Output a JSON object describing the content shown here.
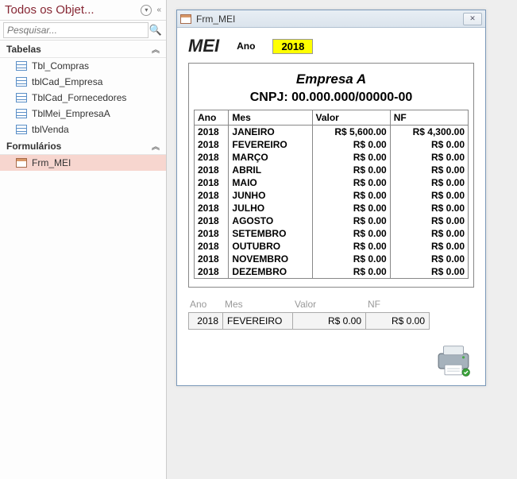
{
  "nav": {
    "title": "Todos os Objet...",
    "search_placeholder": "Pesquisar...",
    "groups": {
      "tables": {
        "label": "Tabelas",
        "items": [
          {
            "label": "Tbl_Compras"
          },
          {
            "label": "tblCad_Empresa"
          },
          {
            "label": "TblCad_Fornecedores"
          },
          {
            "label": "TblMei_EmpresaA"
          },
          {
            "label": "tblVenda"
          }
        ]
      },
      "forms": {
        "label": "Formulários",
        "items": [
          {
            "label": "Frm_MEI"
          }
        ]
      }
    }
  },
  "form": {
    "window_title": "Frm_MEI",
    "title": "MEI",
    "ano_label": "Ano",
    "ano_value": "2018",
    "empresa": "Empresa A",
    "cnpj_label": "CNPJ: 00.000.000/00000-00",
    "table": {
      "headers": {
        "ano": "Ano",
        "mes": "Mes",
        "valor": "Valor",
        "nf": "NF"
      },
      "rows": [
        {
          "ano": "2018",
          "mes": "JANEIRO",
          "valor": "R$ 5,600.00",
          "nf": "R$ 4,300.00"
        },
        {
          "ano": "2018",
          "mes": "FEVEREIRO",
          "valor": "R$ 0.00",
          "nf": "R$ 0.00"
        },
        {
          "ano": "2018",
          "mes": "MARÇO",
          "valor": "R$ 0.00",
          "nf": "R$ 0.00"
        },
        {
          "ano": "2018",
          "mes": "ABRIL",
          "valor": "R$ 0.00",
          "nf": "R$ 0.00"
        },
        {
          "ano": "2018",
          "mes": "MAIO",
          "valor": "R$ 0.00",
          "nf": "R$ 0.00"
        },
        {
          "ano": "2018",
          "mes": "JUNHO",
          "valor": "R$ 0.00",
          "nf": "R$ 0.00"
        },
        {
          "ano": "2018",
          "mes": "JULHO",
          "valor": "R$ 0.00",
          "nf": "R$ 0.00"
        },
        {
          "ano": "2018",
          "mes": "AGOSTO",
          "valor": "R$ 0.00",
          "nf": "R$ 0.00"
        },
        {
          "ano": "2018",
          "mes": "SETEMBRO",
          "valor": "R$ 0.00",
          "nf": "R$ 0.00"
        },
        {
          "ano": "2018",
          "mes": "OUTUBRO",
          "valor": "R$ 0.00",
          "nf": "R$ 0.00"
        },
        {
          "ano": "2018",
          "mes": "NOVEMBRO",
          "valor": "R$ 0.00",
          "nf": "R$ 0.00"
        },
        {
          "ano": "2018",
          "mes": "DEZEMBRO",
          "valor": "R$ 0.00",
          "nf": "R$ 0.00"
        }
      ]
    },
    "footer": {
      "labels": {
        "ano": "Ano",
        "mes": "Mes",
        "valor": "Valor",
        "nf": "NF"
      },
      "values": {
        "ano": "2018",
        "mes": "FEVEREIRO",
        "valor": "R$ 0.00",
        "nf": "R$ 0.00"
      }
    }
  }
}
